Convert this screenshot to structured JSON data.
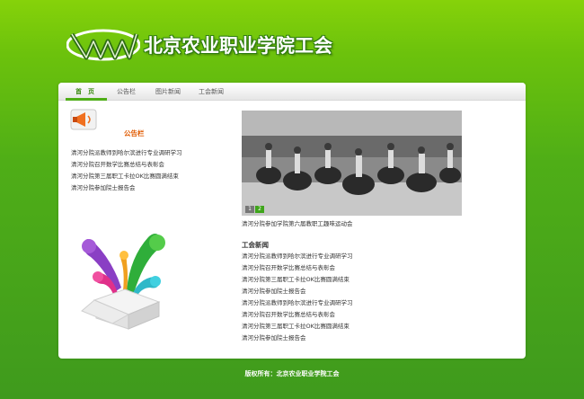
{
  "site": {
    "title": "北京农业职业学院工会"
  },
  "nav": {
    "items": [
      "首　页",
      "公告栏",
      "图片新闻",
      "工会新闻"
    ]
  },
  "notice": {
    "title": "公告栏",
    "items": [
      "清河分院派教师到哈尔滨进行专业调研学习",
      "清河分院召开数学比赛总结与表彰会",
      "清河分院第三届职工卡拉OK比赛圆满结束",
      "清河分院参加院士报告会"
    ]
  },
  "photo_news": {
    "pages": [
      "1",
      "2"
    ],
    "active_page": "2",
    "caption": "清河分院参加学院第六届教职工趣味运动会"
  },
  "union_news": {
    "title": "工会新闻",
    "items": [
      "清河分院派教师到哈尔滨进行专业调研学习",
      "清河分院召开数学比赛总结与表彰会",
      "清河分院第三届职工卡拉OK比赛圆满结束",
      "清河分院参加院士报告会",
      "清河分院派教师到哈尔滨进行专业调研学习",
      "清河分院召开数学比赛总结与表彰会",
      "清河分院第三届职工卡拉OK比赛圆满结束",
      "清河分院参加院士报告会"
    ]
  },
  "footer": {
    "text": "版权所有：北京农业职业学院工会"
  },
  "colors": {
    "brand_green": "#4fae17",
    "notice_orange": "#e05a00"
  }
}
